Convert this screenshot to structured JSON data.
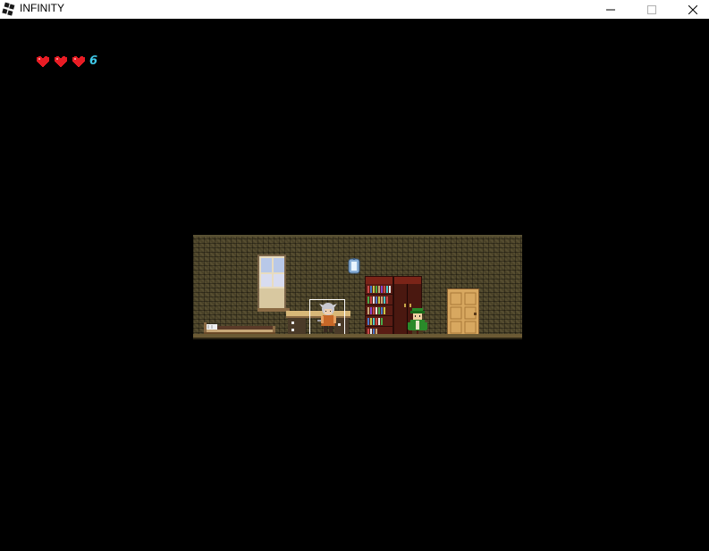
{
  "window": {
    "title": "INFINITY",
    "minimize_glyph": "—",
    "maximize_glyph": "☐",
    "close_glyph": "✕"
  },
  "hud": {
    "hearts": 3,
    "heart_color": "#e81c24",
    "life_count": "6",
    "life_count_color": "#3fc8e8"
  },
  "scene": {
    "icons": [
      "app-icon",
      "heart-icon",
      "lamp-icon"
    ],
    "colors": {
      "wall": "#4a4228",
      "bookshelf": "#5a1c14",
      "wardrobe": "#4a1810",
      "door": "#d8a860",
      "npc_green": "#2a8a2a",
      "player_hair": "#c8c8d0"
    }
  }
}
